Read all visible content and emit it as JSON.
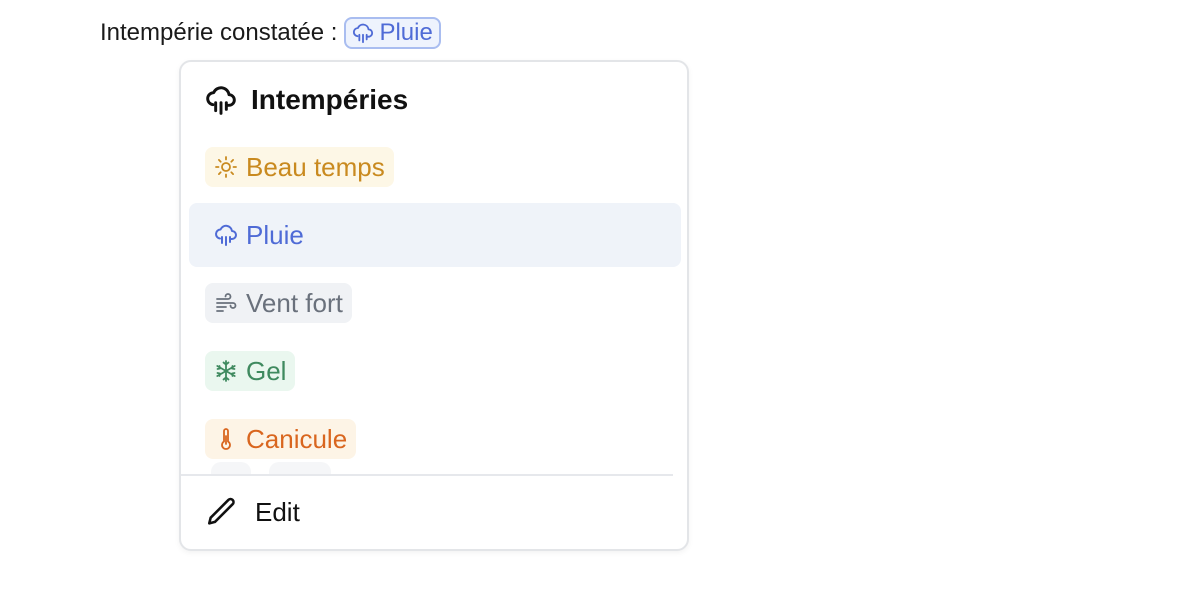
{
  "field": {
    "label": "Intempérie constatée :",
    "selected": {
      "label": "Pluie",
      "icon": "cloud-rain-icon",
      "color": "#4f6bd6"
    }
  },
  "dropdown": {
    "title": "Intempéries",
    "title_icon": "cloud-rain-icon",
    "options": [
      {
        "label": "Beau temps",
        "icon": "sun-icon",
        "color": "#c98a1f",
        "bg": "#fdf7e6",
        "selected": false
      },
      {
        "label": "Pluie",
        "icon": "cloud-rain-icon",
        "color": "#4f6bd6",
        "bg": "#eff3f9",
        "selected": true
      },
      {
        "label": "Vent fort",
        "icon": "wind-icon",
        "color": "#6a717c",
        "bg": "#f0f2f5",
        "selected": false
      },
      {
        "label": "Gel",
        "icon": "snowflake-icon",
        "color": "#3f8a5f",
        "bg": "#eaf7ef",
        "selected": false
      },
      {
        "label": "Canicule",
        "icon": "thermometer-icon",
        "color": "#d9661f",
        "bg": "#fdf4e6",
        "selected": false
      }
    ],
    "edit": {
      "label": "Edit",
      "icon": "pencil-icon"
    }
  }
}
